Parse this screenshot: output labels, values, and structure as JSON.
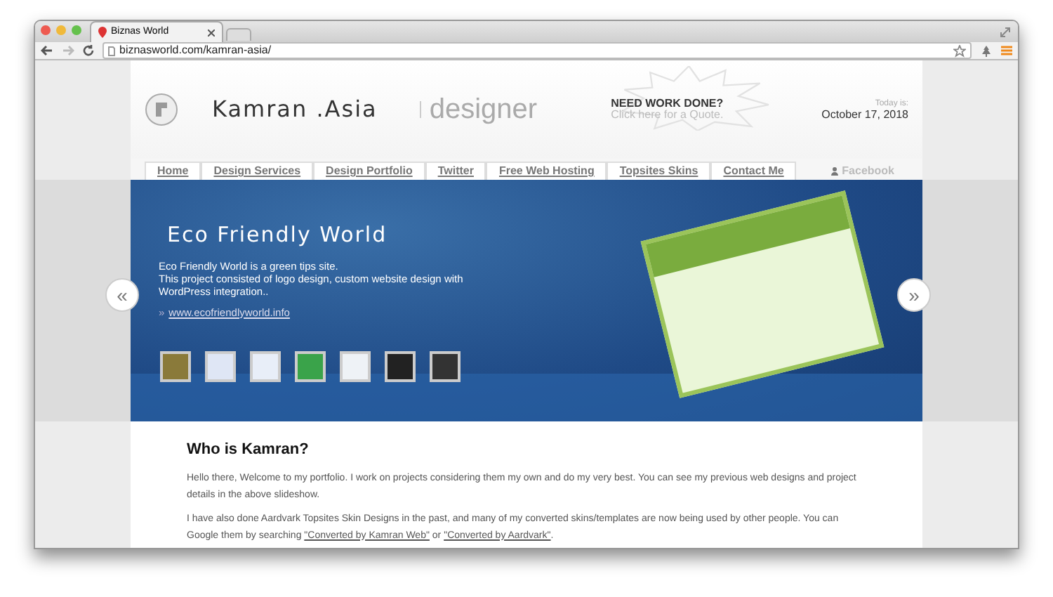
{
  "browser": {
    "tab": {
      "title": "Biznas World",
      "selected": true
    },
    "url": "biznasworld.com/kamran-asia/"
  },
  "header": {
    "brand": "Kamran .Asia",
    "tagline": "designer",
    "promo_title": "NEED WORK DONE?",
    "promo_sub": "Click here for a Quote.",
    "date_label": "Today is:",
    "date": "October 17, 2018"
  },
  "nav": {
    "items": [
      {
        "label": "Home"
      },
      {
        "label": "Design Services"
      },
      {
        "label": "Design Portfolio"
      },
      {
        "label": "Twitter"
      },
      {
        "label": "Free Web Hosting"
      },
      {
        "label": "Topsites Skins"
      },
      {
        "label": "Contact Me"
      }
    ],
    "facebook": "Facebook"
  },
  "slide": {
    "title": "Eco Friendly World",
    "lines": [
      "Eco Friendly World is a green tips site.",
      "This project consisted of logo design, custom website design with WordPress integration.."
    ],
    "link_marker": "»",
    "link": "www.ecofriendlyworld.info",
    "prev": "«",
    "next": "»"
  },
  "about": {
    "heading": "Who is Kamran?",
    "paragraphs": [
      [
        {
          "kind": "text",
          "text": "Hello there, Welcome to my portfolio. I work on projects considering them my own and do my very best. You can see my previous web designs and project details in the above slideshow."
        }
      ],
      [
        {
          "kind": "text",
          "text": "I have also done Aardvark Topsites Skin Designs in the past, and many of my converted skins/templates are now being used by other people. You can Google them by searching "
        },
        {
          "kind": "link",
          "text": "\"Converted by Kamran Web\""
        },
        {
          "kind": "text",
          "text": " or "
        },
        {
          "kind": "link",
          "text": "\"Converted by Aardvark\""
        },
        {
          "kind": "text",
          "text": "."
        }
      ]
    ]
  }
}
